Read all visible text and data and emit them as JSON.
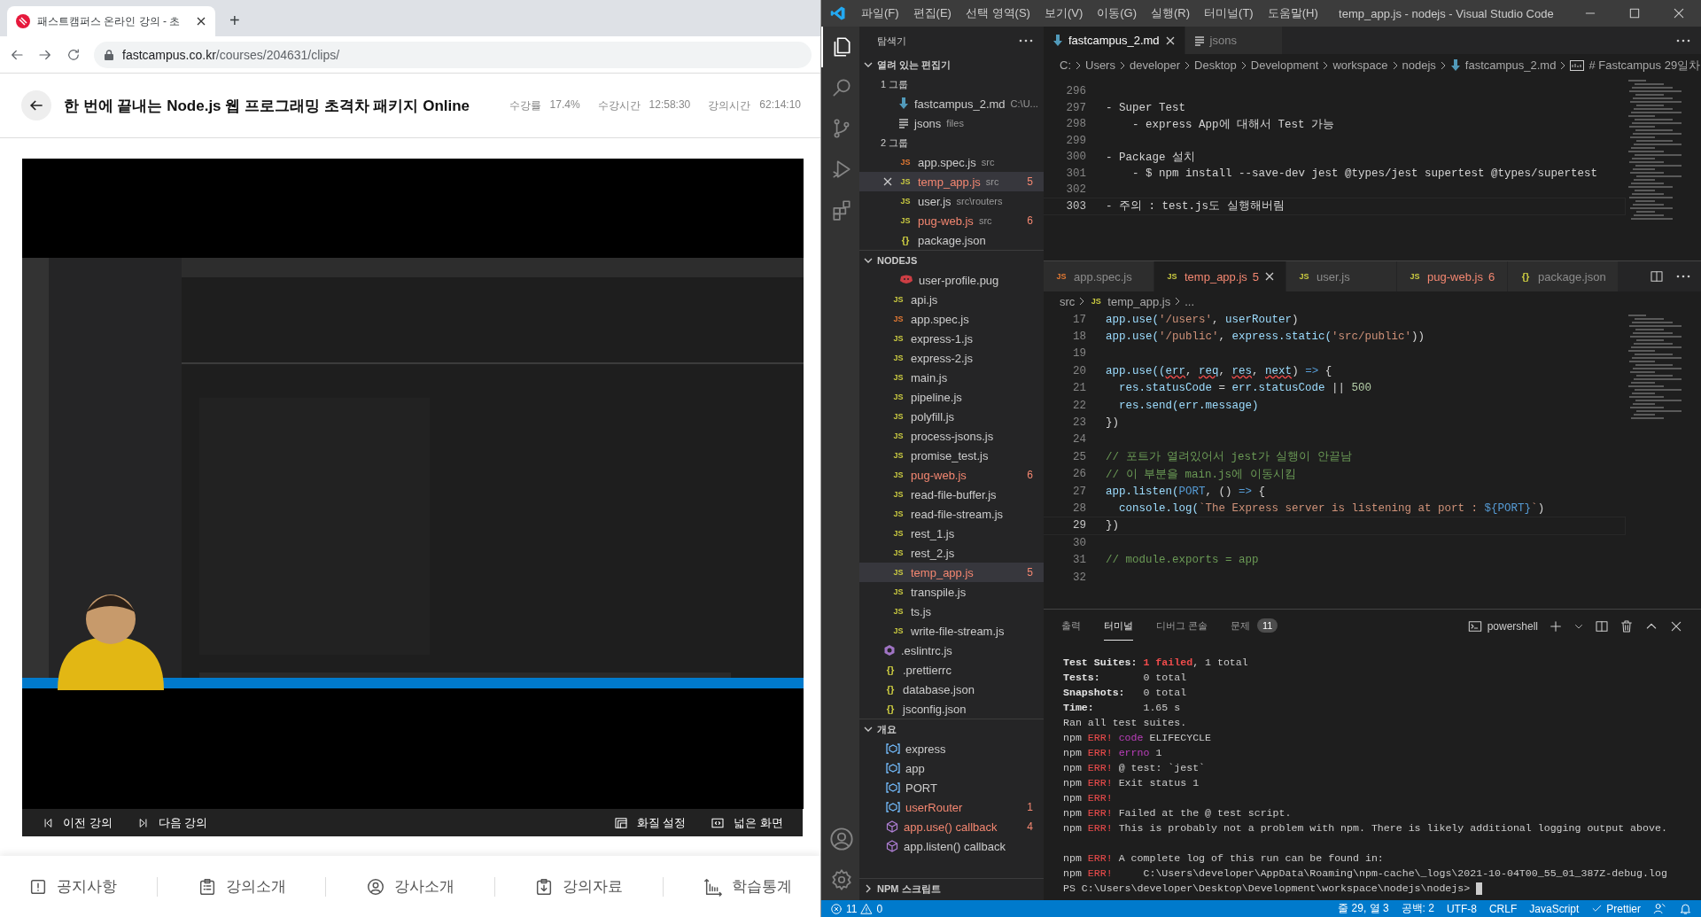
{
  "browser": {
    "tab_title": "패스트캠퍼스 온라인 강의 - 초",
    "new_tab": "+",
    "url": {
      "host": "fastcampus.co.kr",
      "path": "/courses/204631/clips/"
    }
  },
  "course": {
    "title": "한 번에 끝내는 Node.js 웹 프로그래밍 초격차 패키지 Online",
    "stats": [
      {
        "label": "수강률",
        "value": "17.4%"
      },
      {
        "label": "수강시간",
        "value": "12:58:30"
      },
      {
        "label": "강의시간",
        "value": "62:14:10"
      }
    ]
  },
  "player": {
    "controls_left": [
      {
        "kind": "prev",
        "label": "이전 강의"
      },
      {
        "kind": "next",
        "label": "다음 강의"
      }
    ],
    "controls_right": [
      {
        "kind": "quality",
        "label": "화질 설정"
      },
      {
        "kind": "wide",
        "label": "넓은 화면"
      }
    ]
  },
  "bottom_nav": [
    {
      "kind": "notice",
      "label": "공지사항"
    },
    {
      "kind": "clipboard",
      "label": "강의소개"
    },
    {
      "kind": "person",
      "label": "강사소개"
    },
    {
      "kind": "download",
      "label": "강의자료"
    },
    {
      "kind": "chart",
      "label": "학습통계"
    }
  ],
  "vscode": {
    "menu": [
      "파일(F)",
      "편집(E)",
      "선택 영역(S)",
      "보기(V)",
      "이동(G)",
      "실행(R)",
      "터미널(T)",
      "도움말(H)"
    ],
    "title": "temp_app.js - nodejs - Visual Studio Code",
    "activity": [
      {
        "kind": "files",
        "selected": true
      },
      {
        "kind": "search",
        "selected": false
      },
      {
        "kind": "source-control",
        "selected": false
      },
      {
        "kind": "run",
        "selected": false
      },
      {
        "kind": "extensions",
        "selected": false
      }
    ],
    "explorer": {
      "title": "탐색기",
      "open_editors": {
        "title": "열려 있는 편집기",
        "expanded": true,
        "groups": [
          {
            "label": "1 그룹",
            "files": [
              {
                "kind": "md",
                "name": "fastcampus_2.md",
                "desc": "C:\\U...",
                "error": false,
                "selected": false
              },
              {
                "kind": "list",
                "name": "jsons",
                "desc": "files",
                "error": false,
                "selected": false
              }
            ]
          },
          {
            "label": "2 그룹",
            "files": [
              {
                "kind": "jstest",
                "glyph": "JS",
                "name": "app.spec.js",
                "desc": "src",
                "error": false,
                "selected": false
              },
              {
                "kind": "js",
                "glyph": "JS",
                "name": "temp_app.js",
                "desc": "src",
                "badge": "5",
                "error": true,
                "selected": true
              },
              {
                "kind": "js",
                "glyph": "JS",
                "name": "user.js",
                "desc": "src\\routers",
                "error": false,
                "selected": false
              },
              {
                "kind": "js",
                "glyph": "JS",
                "name": "pug-web.js",
                "desc": "src",
                "badge": "6",
                "error": true,
                "selected": false
              },
              {
                "kind": "json",
                "glyph": "{}",
                "name": "package.json",
                "error": false,
                "selected": false
              }
            ]
          }
        ]
      },
      "folder": {
        "title": "NODEJS",
        "expanded": true,
        "tree": [
          {
            "children": [
              {
                "children": [
                  {
                    "kind": "pug",
                    "name": "user-profile.pug",
                    "error": false,
                    "selected": false
                  }
                ]
              },
              {
                "kind": "js",
                "glyph": "JS",
                "name": "api.js",
                "error": false,
                "selected": false
              },
              {
                "kind": "jstest",
                "glyph": "JS",
                "name": "app.spec.js",
                "error": false,
                "selected": false
              },
              {
                "kind": "js",
                "glyph": "JS",
                "name": "express-1.js",
                "error": false,
                "selected": false
              },
              {
                "kind": "js",
                "glyph": "JS",
                "name": "express-2.js",
                "error": false,
                "selected": false
              },
              {
                "kind": "js",
                "glyph": "JS",
                "name": "main.js",
                "error": false,
                "selected": false
              },
              {
                "kind": "js",
                "glyph": "JS",
                "name": "pipeline.js",
                "error": false,
                "selected": false
              },
              {
                "kind": "js",
                "glyph": "JS",
                "name": "polyfill.js",
                "error": false,
                "selected": false
              },
              {
                "kind": "js",
                "glyph": "JS",
                "name": "process-jsons.js",
                "error": false,
                "selected": false
              },
              {
                "kind": "js",
                "glyph": "JS",
                "name": "promise_test.js",
                "error": false,
                "selected": false
              },
              {
                "kind": "js",
                "glyph": "JS",
                "name": "pug-web.js",
                "badge": "6",
                "error": true,
                "selected": false
              },
              {
                "kind": "js",
                "glyph": "JS",
                "name": "read-file-buffer.js",
                "error": false,
                "selected": false
              },
              {
                "kind": "js",
                "glyph": "JS",
                "name": "read-file-stream.js",
                "error": false,
                "selected": false
              },
              {
                "kind": "js",
                "glyph": "JS",
                "name": "rest_1.js",
                "error": false,
                "selected": false
              },
              {
                "kind": "js",
                "glyph": "JS",
                "name": "rest_2.js",
                "error": false,
                "selected": false
              },
              {
                "kind": "js",
                "glyph": "JS",
                "name": "temp_app.js",
                "badge": "5",
                "error": true,
                "selected": true
              },
              {
                "kind": "js",
                "glyph": "JS",
                "name": "transpile.js",
                "error": false,
                "selected": false
              },
              {
                "kind": "js",
                "glyph": "JS",
                "name": "ts.js",
                "error": false,
                "selected": false
              },
              {
                "kind": "js",
                "glyph": "JS",
                "name": "write-file-stream.js",
                "error": false,
                "selected": false
              }
            ]
          },
          {
            "kind": "eslint",
            "name": ".eslintrc.js",
            "error": false,
            "selected": false
          },
          {
            "kind": "json",
            "glyph": "{}",
            "name": ".prettierrc",
            "error": false,
            "selected": false
          },
          {
            "kind": "json",
            "glyph": "{}",
            "name": "database.json",
            "error": false,
            "selected": false
          },
          {
            "kind": "json",
            "glyph": "{}",
            "name": "jsconfig.json",
            "error": false,
            "selected": false
          }
        ]
      },
      "outline": {
        "title": "개요",
        "expanded": true,
        "items": [
          {
            "kind": "var",
            "name": "express",
            "error": false
          },
          {
            "kind": "var",
            "name": "app",
            "error": false
          },
          {
            "kind": "var",
            "name": "PORT",
            "error": false
          },
          {
            "kind": "var",
            "name": "userRouter",
            "badge": "1",
            "error": true
          },
          {
            "kind": "method",
            "name": "app.use() callback",
            "badge": "4",
            "error": true
          },
          {
            "kind": "method",
            "name": "app.listen() callback",
            "error": false
          }
        ]
      },
      "npm_scripts": {
        "title": "NPM 스크립트",
        "expanded": false
      }
    },
    "editor_top": {
      "tabs": [
        {
          "kind": "md",
          "label": "fastcampus_2.md",
          "selected": true
        },
        {
          "kind": "list",
          "label": "jsons",
          "selected": false
        }
      ],
      "breadcrumbs": [
        {
          "label": "C:"
        },
        {
          "label": "Users"
        },
        {
          "label": "developer"
        },
        {
          "label": "Desktop"
        },
        {
          "label": "Development"
        },
        {
          "label": "workspace"
        },
        {
          "label": "nodejs"
        },
        {
          "kind": "md",
          "label": "fastcampus_2.md"
        },
        {
          "kind": "abc",
          "label": "# Fastcampus 29일차"
        }
      ],
      "lines": [
        {
          "number": "296",
          "current": false
        },
        {
          "number": "297",
          "current": false,
          "tokens": [
            {
              "text": "- Super Test",
              "kind": "plain"
            }
          ]
        },
        {
          "number": "298",
          "current": false,
          "tokens": [
            {
              "text": "    - express App에 대해서 Test 가능",
              "kind": "plain"
            }
          ]
        },
        {
          "number": "299",
          "current": false
        },
        {
          "number": "300",
          "current": false,
          "tokens": [
            {
              "text": "- Package 설치",
              "kind": "plain"
            }
          ]
        },
        {
          "number": "301",
          "current": false,
          "tokens": [
            {
              "text": "    - $ npm install --save-dev jest @types/jest supertest @types/supertest",
              "kind": "plain"
            }
          ]
        },
        {
          "number": "302",
          "current": false
        },
        {
          "number": "303",
          "current": true,
          "tokens": [
            {
              "text": "- 주의 : test.js도 실행해버림",
              "kind": "plain"
            }
          ]
        }
      ]
    },
    "editor_bottom": {
      "tabs": [
        {
          "kind": "jstest",
          "glyph": "JS",
          "label": "app.spec.js",
          "selected": false,
          "error": false
        },
        {
          "kind": "js",
          "glyph": "JS",
          "label": "temp_app.js",
          "badge": "5",
          "selected": true,
          "error": true
        },
        {
          "kind": "js",
          "glyph": "JS",
          "label": "user.js",
          "selected": false,
          "error": false
        },
        {
          "kind": "js",
          "glyph": "JS",
          "label": "pug-web.js",
          "badge": "6",
          "selected": false,
          "error": true
        },
        {
          "kind": "json",
          "glyph": "{}",
          "label": "package.json",
          "selected": false,
          "error": false
        }
      ],
      "breadcrumbs": [
        {
          "label": "src"
        },
        {
          "kind": "js",
          "glyph": "JS",
          "label": "temp_app.js"
        },
        {
          "label": "..."
        }
      ],
      "lines": [
        {
          "number": "17",
          "current": false,
          "tokens": [
            {
              "text": "app.use(",
              "kind": "var"
            },
            {
              "text": "'/users'",
              "kind": "string"
            },
            {
              "text": ", ",
              "kind": "plain"
            },
            {
              "text": "userRouter",
              "kind": "var"
            },
            {
              "text": ")",
              "kind": "plain"
            }
          ]
        },
        {
          "number": "18",
          "current": false,
          "tokens": [
            {
              "text": "app.use(",
              "kind": "var"
            },
            {
              "text": "'/public'",
              "kind": "string"
            },
            {
              "text": ", ",
              "kind": "plain"
            },
            {
              "text": "express.static(",
              "kind": "var"
            },
            {
              "text": "'src/public'",
              "kind": "string"
            },
            {
              "text": "))",
              "kind": "plain"
            }
          ]
        },
        {
          "number": "19",
          "current": false
        },
        {
          "number": "20",
          "current": false,
          "tokens": [
            {
              "text": "app.use((",
              "kind": "var"
            },
            {
              "text": "err",
              "kind": "squiggle"
            },
            {
              "text": ", ",
              "kind": "plain"
            },
            {
              "text": "req",
              "kind": "squiggle"
            },
            {
              "text": ", ",
              "kind": "plain"
            },
            {
              "text": "res",
              "kind": "squiggle"
            },
            {
              "text": ", ",
              "kind": "plain"
            },
            {
              "text": "next",
              "kind": "squiggle"
            },
            {
              "text": ") ",
              "kind": "plain"
            },
            {
              "text": "=>",
              "kind": "keyword"
            },
            {
              "text": " {",
              "kind": "plain"
            }
          ]
        },
        {
          "number": "21",
          "current": false,
          "tokens": [
            {
              "text": "  res.statusCode",
              "kind": "var"
            },
            {
              "text": " = ",
              "kind": "plain"
            },
            {
              "text": "err.statusCode",
              "kind": "var"
            },
            {
              "text": " || ",
              "kind": "plain"
            },
            {
              "text": "500",
              "kind": "number"
            }
          ]
        },
        {
          "number": "22",
          "current": false,
          "tokens": [
            {
              "text": "  res.send(err.message)",
              "kind": "var"
            }
          ]
        },
        {
          "number": "23",
          "current": false,
          "tokens": [
            {
              "text": "})",
              "kind": "plain"
            }
          ]
        },
        {
          "number": "24",
          "current": false
        },
        {
          "number": "25",
          "current": false,
          "tokens": [
            {
              "text": "// 포트가 열려있어서 jest가 실행이 안끝남",
              "kind": "comment"
            }
          ]
        },
        {
          "number": "26",
          "current": false,
          "tokens": [
            {
              "text": "// 이 부분을 main.js에 이동시킴",
              "kind": "comment"
            }
          ]
        },
        {
          "number": "27",
          "current": false,
          "tokens": [
            {
              "text": "app.listen(",
              "kind": "var"
            },
            {
              "text": "PORT",
              "kind": "keyword"
            },
            {
              "text": ", () ",
              "kind": "plain"
            },
            {
              "text": "=>",
              "kind": "keyword"
            },
            {
              "text": " {",
              "kind": "plain"
            }
          ]
        },
        {
          "number": "28",
          "current": false,
          "tokens": [
            {
              "text": "  console.log(",
              "kind": "var"
            },
            {
              "text": "`The Express server is listening at port : ",
              "kind": "string"
            },
            {
              "text": "${PORT}",
              "kind": "keyword"
            },
            {
              "text": "`",
              "kind": "string"
            },
            {
              "text": ")",
              "kind": "plain"
            }
          ]
        },
        {
          "number": "29",
          "current": true,
          "tokens": [
            {
              "text": "})",
              "kind": "plain"
            }
          ]
        },
        {
          "number": "30",
          "current": false
        },
        {
          "number": "31",
          "current": false,
          "tokens": [
            {
              "text": "// module.exports = app",
              "kind": "comment"
            }
          ]
        },
        {
          "number": "32",
          "current": false
        }
      ]
    },
    "panel": {
      "tabs": [
        {
          "label": "출력",
          "selected": false
        },
        {
          "label": "터미널",
          "selected": true
        },
        {
          "label": "디버그 콘솔",
          "selected": false
        },
        {
          "label": "문제",
          "badge": "11",
          "selected": false
        }
      ],
      "shell": "powershell",
      "lines": [
        {
          "tokens": [
            {
              "text": "Test Suites: ",
              "kind": "bold"
            },
            {
              "text": "1 failed",
              "kind": "redbold"
            },
            {
              "text": ", 1 total",
              "kind": "plain"
            }
          ]
        },
        {
          "tokens": [
            {
              "text": "Tests:",
              "kind": "bold"
            },
            {
              "text": "       0 total",
              "kind": "plain"
            }
          ]
        },
        {
          "tokens": [
            {
              "text": "Snapshots:",
              "kind": "bold"
            },
            {
              "text": "   0 total",
              "kind": "plain"
            }
          ]
        },
        {
          "tokens": [
            {
              "text": "Time:",
              "kind": "bold"
            },
            {
              "text": "        1.65 s",
              "kind": "plain"
            }
          ]
        },
        {
          "tokens": [
            {
              "text": "Ran all test suites.",
              "kind": "plain"
            }
          ]
        },
        {
          "tokens": [
            {
              "text": "npm ",
              "kind": "plain"
            },
            {
              "text": "ERR!",
              "kind": "red"
            },
            {
              "text": " code",
              "kind": "magenta"
            },
            {
              "text": " ELIFECYCLE",
              "kind": "plain"
            }
          ]
        },
        {
          "tokens": [
            {
              "text": "npm ",
              "kind": "plain"
            },
            {
              "text": "ERR!",
              "kind": "red"
            },
            {
              "text": " errno",
              "kind": "magenta"
            },
            {
              "text": " 1",
              "kind": "plain"
            }
          ]
        },
        {
          "tokens": [
            {
              "text": "npm ",
              "kind": "plain"
            },
            {
              "text": "ERR!",
              "kind": "red"
            },
            {
              "text": " @ test: `jest`",
              "kind": "plain"
            }
          ]
        },
        {
          "tokens": [
            {
              "text": "npm ",
              "kind": "plain"
            },
            {
              "text": "ERR!",
              "kind": "red"
            },
            {
              "text": " Exit status 1",
              "kind": "plain"
            }
          ]
        },
        {
          "tokens": [
            {
              "text": "npm ",
              "kind": "plain"
            },
            {
              "text": "ERR!",
              "kind": "red"
            }
          ]
        },
        {
          "tokens": [
            {
              "text": "npm ",
              "kind": "plain"
            },
            {
              "text": "ERR!",
              "kind": "red"
            },
            {
              "text": " Failed at the @ test script.",
              "kind": "plain"
            }
          ]
        },
        {
          "tokens": [
            {
              "text": "npm ",
              "kind": "plain"
            },
            {
              "text": "ERR!",
              "kind": "red"
            },
            {
              "text": " This is probably not a problem with npm. There is likely additional logging output above.",
              "kind": "plain"
            }
          ]
        },
        {
          "gap_before": true,
          "tokens": [
            {
              "text": "npm ",
              "kind": "plain"
            },
            {
              "text": "ERR!",
              "kind": "red"
            },
            {
              "text": " A complete log of this run can be found in:",
              "kind": "plain"
            }
          ]
        },
        {
          "tokens": [
            {
              "text": "npm ",
              "kind": "plain"
            },
            {
              "text": "ERR!",
              "kind": "red"
            },
            {
              "text": "     C:\\Users\\developer\\AppData\\Roaming\\npm-cache\\_logs\\2021-10-04T00_55_01_387Z-debug.log",
              "kind": "plain"
            }
          ]
        },
        {
          "tokens": [
            {
              "text": "PS C:\\Users\\developer\\Desktop\\Development\\workspace\\nodejs\\nodejs> ",
              "kind": "plain"
            },
            {
              "kind": "cursor"
            }
          ]
        }
      ]
    },
    "status": {
      "errors": "11",
      "warnings": "0",
      "items": [
        "줄 29, 열 3",
        "공백: 2",
        "UTF-8",
        "CRLF",
        "JavaScript"
      ],
      "prettier": "Prettier"
    }
  }
}
